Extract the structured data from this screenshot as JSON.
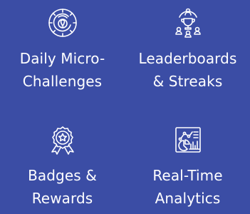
{
  "background_color": "#3b4da5",
  "text_color": "#ffffff",
  "features": [
    {
      "icon": "maze-target-icon",
      "label": "Daily Micro-\nChallenges"
    },
    {
      "icon": "trophy-team-icon",
      "label": "Leaderboards\n& Streaks"
    },
    {
      "icon": "badge-medal-icon",
      "label": "Badges &\nRewards"
    },
    {
      "icon": "analytics-chart-icon",
      "label": "Real-Time\nAnalytics"
    }
  ]
}
